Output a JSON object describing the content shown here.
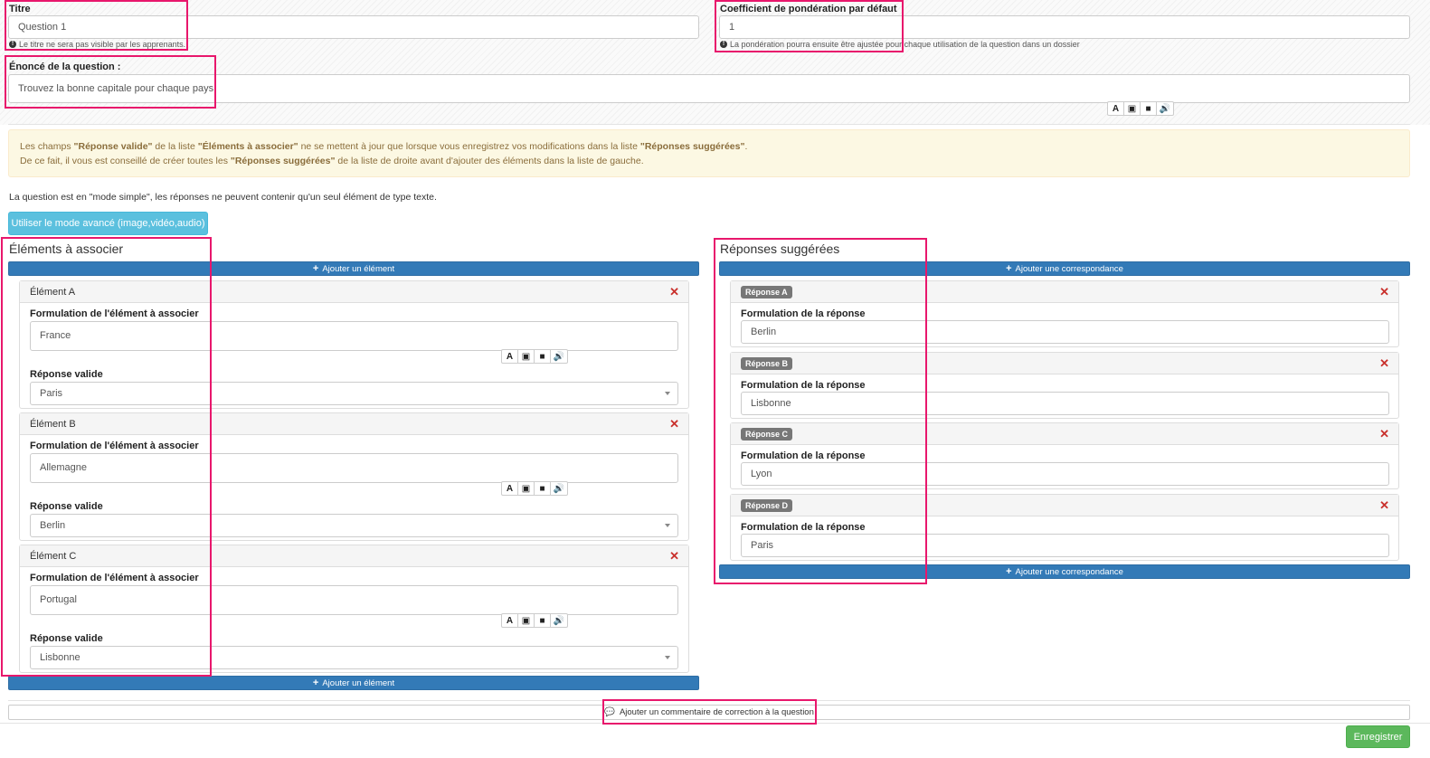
{
  "title_field": {
    "label": "Titre",
    "value": "Question 1",
    "help": "Le titre ne sera pas visible par les apprenants."
  },
  "coef_field": {
    "label": "Coefficient de pondération par défaut",
    "value": "1",
    "help": "La pondération pourra ensuite être ajustée pour chaque utilisation de la question dans un dossier"
  },
  "statement_field": {
    "label": "Énoncé de la question :",
    "value": "Trouvez la bonne capitale pour chaque pays."
  },
  "alert": {
    "line1_a": "Les champs ",
    "line1_b": "\"Réponse valide\"",
    "line1_c": " de la liste ",
    "line1_d": "\"Éléments à associer\"",
    "line1_e": " ne se mettent à jour que lorsque vous enregistrez vos modifications dans la liste ",
    "line1_f": "\"Réponses suggérées\"",
    "line1_g": ".",
    "line2_a": "De ce fait, il vous est conseillé de créer toutes les ",
    "line2_b": "\"Réponses suggérées\"",
    "line2_c": " de la liste de droite avant d'ajouter des éléments dans la liste de gauche."
  },
  "mode_note": "La question est en \"mode simple\", les réponses ne peuvent contenir qu'un seul élément de type texte.",
  "advanced_mode_button": "Utiliser le mode avancé (image,vidéo,audio)",
  "left": {
    "heading": "Éléments à associer",
    "add_button": "Ajouter un élément",
    "formulation_label": "Formulation de l'élément à associer",
    "valid_label": "Réponse valide",
    "items": [
      {
        "title": "Élément A",
        "formulation": "France",
        "valid": "Paris"
      },
      {
        "title": "Élément B",
        "formulation": "Allemagne",
        "valid": "Berlin"
      },
      {
        "title": "Élément C",
        "formulation": "Portugal",
        "valid": "Lisbonne"
      }
    ]
  },
  "right": {
    "heading": "Réponses suggérées",
    "add_button": "Ajouter une correspondance",
    "formulation_label": "Formulation de la réponse",
    "items": [
      {
        "badge": "Réponse A",
        "value": "Berlin"
      },
      {
        "badge": "Réponse B",
        "value": "Lisbonne"
      },
      {
        "badge": "Réponse C",
        "value": "Lyon"
      },
      {
        "badge": "Réponse D",
        "value": "Paris"
      }
    ]
  },
  "comment_button": "Ajouter un commentaire de correction à la question",
  "save_button": "Enregistrer",
  "colors": {
    "highlight": "#e8176c",
    "primary": "#337ab7",
    "info": "#5bc0de",
    "success": "#5cb85c",
    "danger": "#c9302c"
  }
}
